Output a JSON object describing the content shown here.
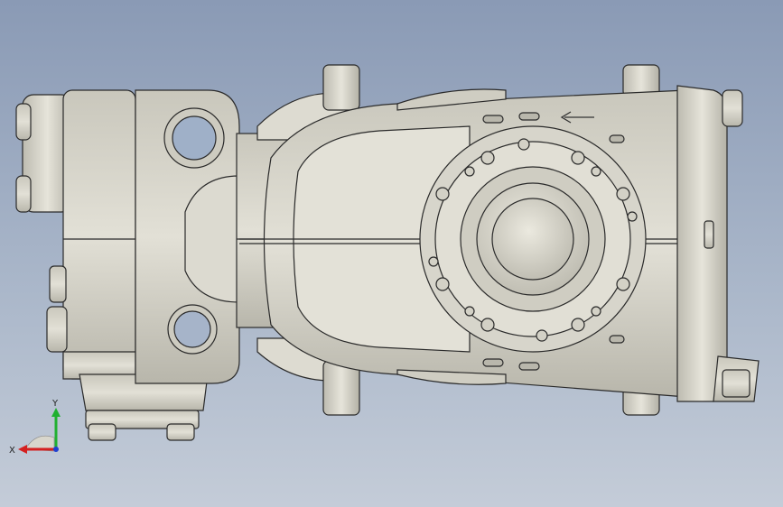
{
  "triad": {
    "x_label": "X",
    "y_label": "Y",
    "colors": {
      "x": "#d42020",
      "y": "#20b030",
      "z": "#2040d0"
    }
  },
  "colors": {
    "background_top": "#8a9ab5",
    "background_bottom": "#c4ccd8",
    "part_fill": "#d8d6cc",
    "part_edge": "#2a2a2a"
  }
}
